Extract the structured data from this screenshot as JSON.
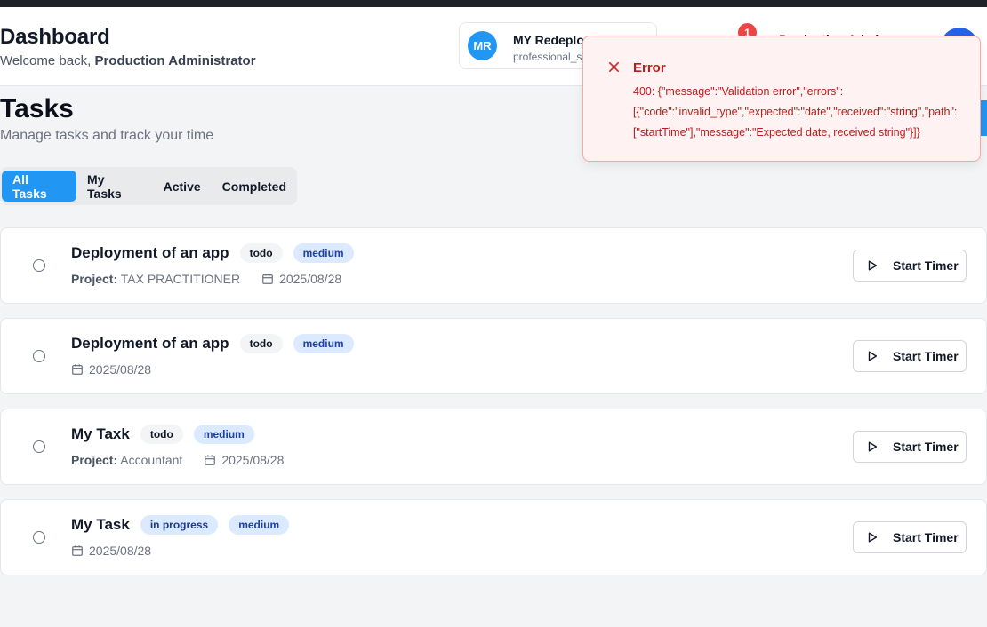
{
  "header": {
    "title": "Dashboard",
    "welcome_prefix": "Welcome back,",
    "user_full_name": "Production Administrator",
    "workspace": {
      "initials": "MR",
      "name": "MY Redeploy",
      "plan": "professional_s"
    },
    "notifications_count": "1",
    "user_name_partial": "Production Admin",
    "colors": {
      "brand": "#2196f3",
      "badge": "#ef4444"
    }
  },
  "page": {
    "title": "Tasks",
    "subtitle": "Manage tasks and track your time"
  },
  "tabs": [
    {
      "label": "All Tasks",
      "active": true
    },
    {
      "label": "My Tasks",
      "active": false
    },
    {
      "label": "Active",
      "active": false
    },
    {
      "label": "Completed",
      "active": false
    }
  ],
  "tasks": [
    {
      "title": "Deployment of an app",
      "status": "todo",
      "priority": "medium",
      "project_label": "Project:",
      "project": "TAX PRACTITIONER",
      "date": "2025/08/28",
      "action": "Start Timer"
    },
    {
      "title": "Deployment of an app",
      "status": "todo",
      "priority": "medium",
      "project_label": "",
      "project": "",
      "date": "2025/08/28",
      "action": "Start Timer"
    },
    {
      "title": "My Taxk",
      "status": "todo",
      "priority": "medium",
      "project_label": "Project:",
      "project": "Accountant",
      "date": "2025/08/28",
      "action": "Start Timer"
    },
    {
      "title": "My Task",
      "status": "in progress",
      "priority": "medium",
      "project_label": "",
      "project": "",
      "date": "2025/08/28",
      "action": "Start Timer"
    }
  ],
  "toast": {
    "title": "Error",
    "message": "400: {\"message\":\"Validation error\",\"errors\":\n[{\"code\":\"invalid_type\",\"expected\":\"date\",\"received\":\"string\",\"path\":\n[\"startTime\"],\"message\":\"Expected date, received string\"}]}",
    "colors": {
      "text": "#b91c1c",
      "background": "#fef2f2",
      "border": "#fca5a5"
    }
  }
}
